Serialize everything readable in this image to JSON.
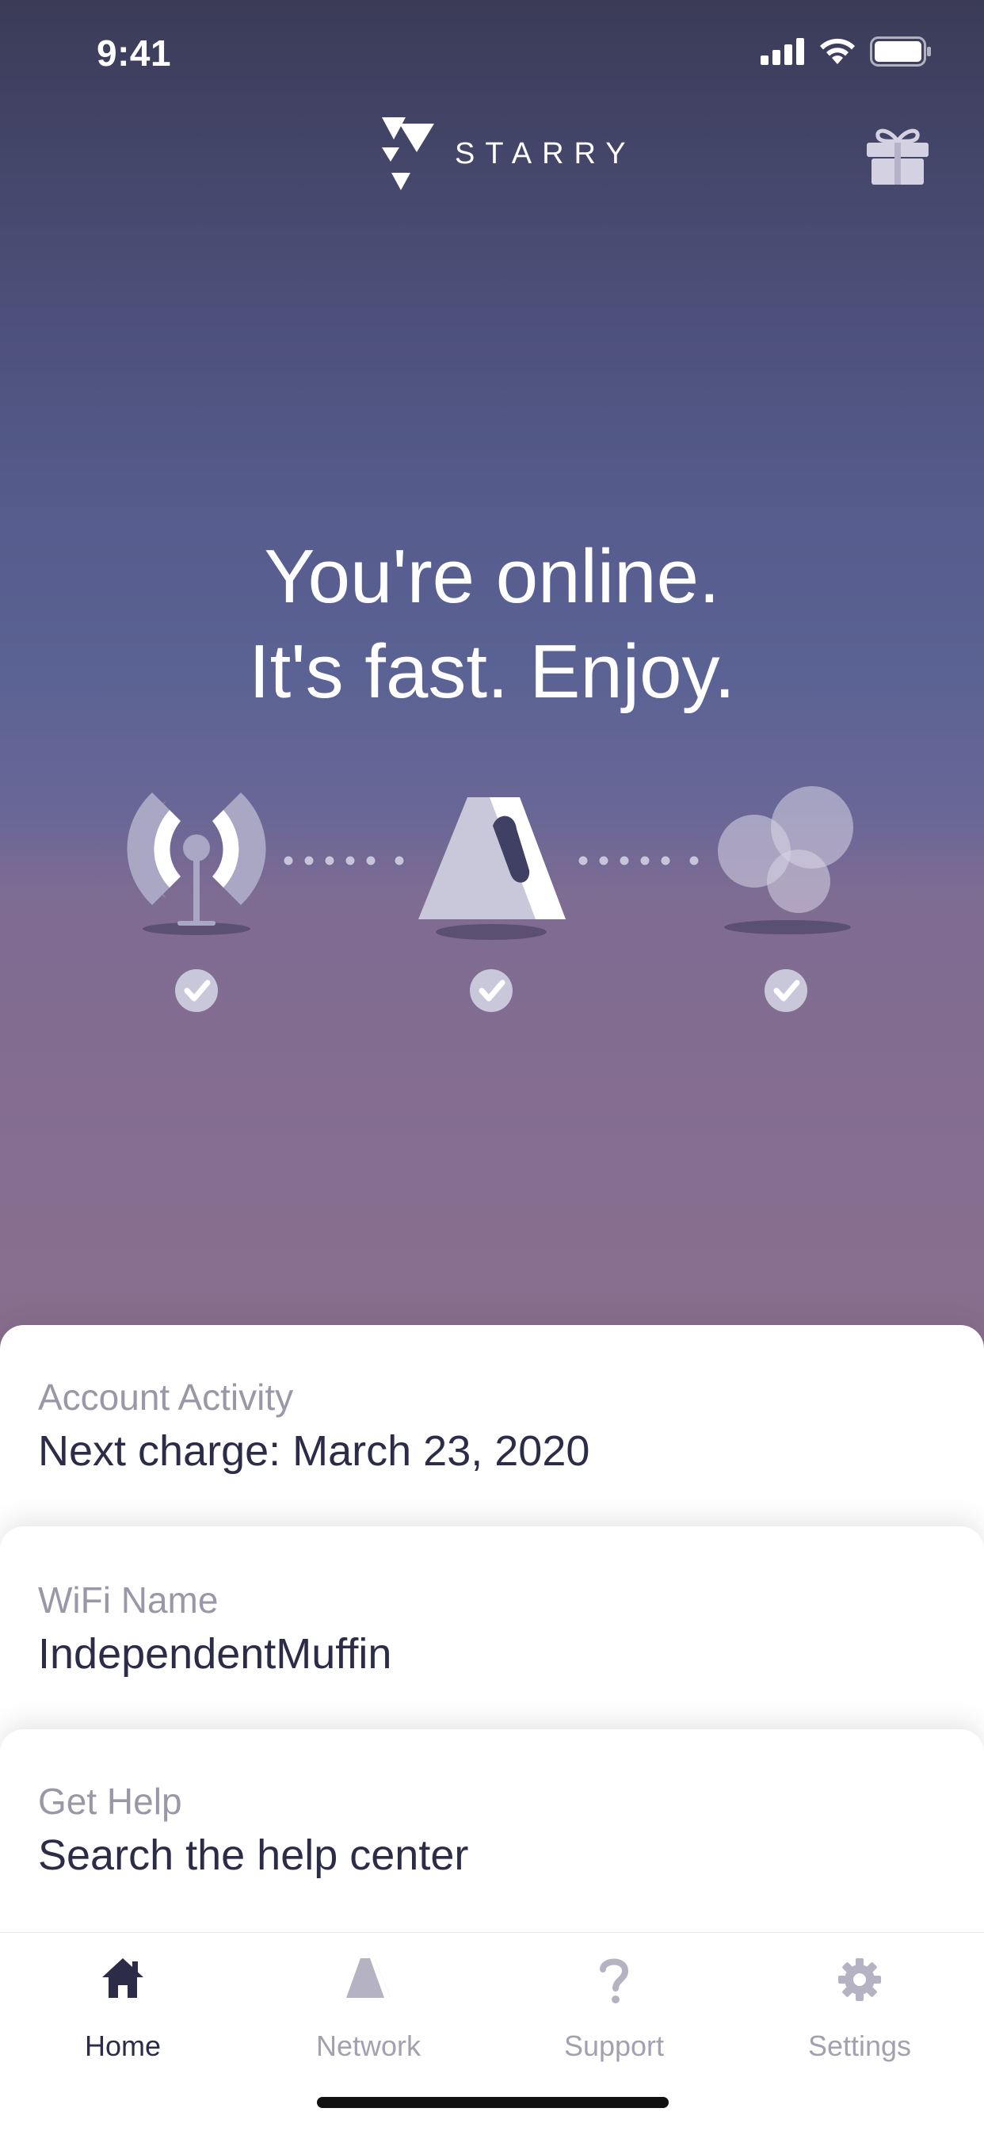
{
  "status_bar": {
    "time": "9:41"
  },
  "header": {
    "logo_text": "STARRY"
  },
  "hero": {
    "headline_line1": "You're online.",
    "headline_line2": "It's fast. Enjoy."
  },
  "cards": [
    {
      "label": "Account Activity",
      "value": "Next charge: March 23, 2020"
    },
    {
      "label": "WiFi Name",
      "value": "IndependentMuffin"
    },
    {
      "label": "Get Help",
      "value": "Search the help center"
    }
  ],
  "tabs": [
    {
      "label": "Home",
      "icon": "home-icon",
      "active": true
    },
    {
      "label": "Network",
      "icon": "network-icon",
      "active": false
    },
    {
      "label": "Support",
      "icon": "support-icon",
      "active": false
    },
    {
      "label": "Settings",
      "icon": "settings-icon",
      "active": false
    }
  ],
  "colors": {
    "text_dark": "#2d2c48",
    "text_muted": "#9a98a7",
    "tab_inactive": "#a3a1b0"
  }
}
